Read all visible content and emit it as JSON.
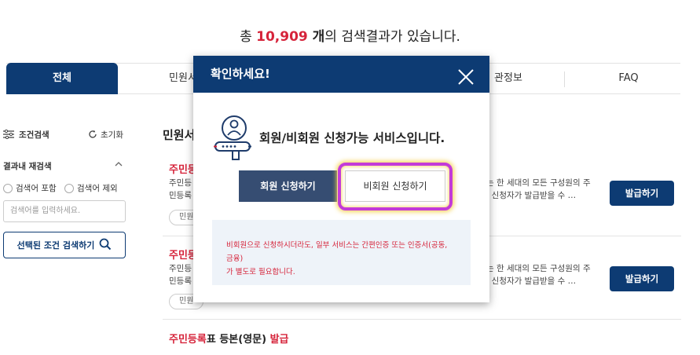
{
  "summary": {
    "prefix": "총 ",
    "count": "10,909",
    "unit": " 개",
    "suffix": "의 검색결과가 있습니다."
  },
  "tabs": [
    {
      "label": "전체"
    },
    {
      "label": "민원서"
    },
    {
      "label": "관정보"
    },
    {
      "label": "FAQ"
    }
  ],
  "sidebar": {
    "condition_search": "조건검색",
    "reset": "초기화",
    "research_title": "결과내 재검색",
    "include_label": "검색어 포함",
    "exclude_label": "검색어 제외",
    "input_placeholder": "검색어를 입력하세요.",
    "search_button": "선택된 조건 검색하기"
  },
  "content": {
    "section_title": "민원서",
    "items": [
      {
        "title_red": "주민등",
        "title_rest": "",
        "desc_left_1": "주민등",
        "desc_left_2": "민등록",
        "desc_right_1": "는 한 세대의 모든 구성원의 주",
        "desc_right_2": ". 신청자가 발급받을 수 …",
        "tag": "민원",
        "button": "발급하기"
      },
      {
        "title_red": "주민등",
        "title_rest": "",
        "desc_left_1": "주민등",
        "desc_left_2": "민등록",
        "desc_right_1": "는 한 세대의 모든 구성원의 주",
        "desc_right_2": ". 신청자가 발급받을 수 …",
        "tag": "민원",
        "button": "발급하기"
      },
      {
        "title_red": "주민등록",
        "title_rest": "표 등본(영문) ",
        "title_red2": "발급"
      }
    ]
  },
  "modal": {
    "title": "확인하세요!",
    "message": "회원/비회원 신청가능 서비스입니다.",
    "member_button": "회원 신청하기",
    "nonmember_button": "비회원 신청하기",
    "notice_line1": "비회원으로 신청하시더라도, 일부 서비스는 간편인증 또는 인증서(공동, 금융)",
    "notice_line2": "가 별도로 필요합니다."
  },
  "colors": {
    "primary_navy": "#0d3b73",
    "member_button": "#364d72",
    "accent_red": "#d6243b",
    "highlight_purple": "#c33bd8"
  }
}
